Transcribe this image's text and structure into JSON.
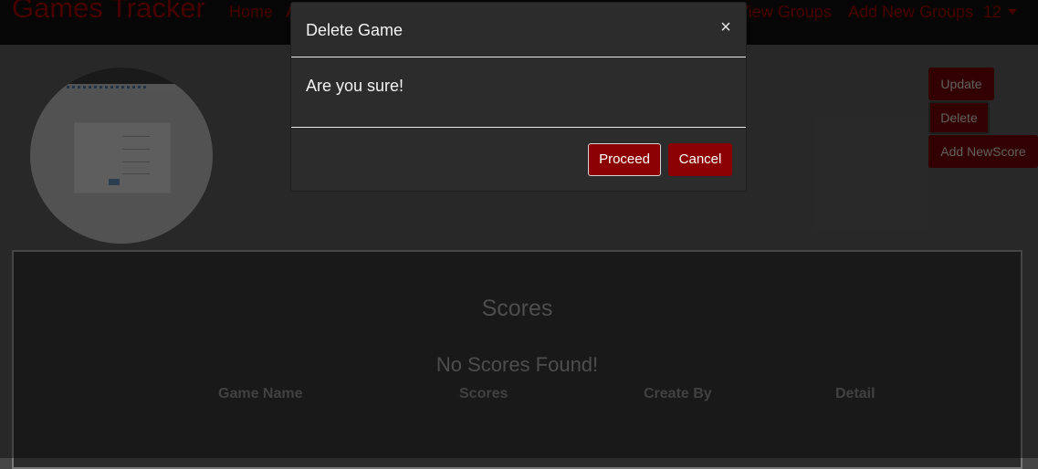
{
  "navbar": {
    "brand": "Games Tracker",
    "home": "Home",
    "hidden_fragment": "A",
    "view_groups": "View Groups",
    "add_groups": "Add New Groups",
    "user": "12"
  },
  "actions": {
    "update": "Update",
    "delete": "Delete",
    "add_score": "Add NewScore"
  },
  "scores": {
    "title": "Scores",
    "empty_message": "No Scores Found!",
    "columns": [
      "Game Name",
      "Scores",
      "Create By",
      "Detail"
    ]
  },
  "modal": {
    "title": "Delete Game",
    "close_symbol": "×",
    "message": "Are you sure!",
    "proceed": "Proceed",
    "cancel": "Cancel"
  },
  "colors": {
    "brand_red": "#7a0000",
    "button_red": "#8b0000",
    "navbar_bg": "#0b0b0b",
    "modal_bg": "#2c2c2c"
  },
  "icons": {
    "close": "close-icon",
    "dropdown": "chevron-down-icon"
  }
}
